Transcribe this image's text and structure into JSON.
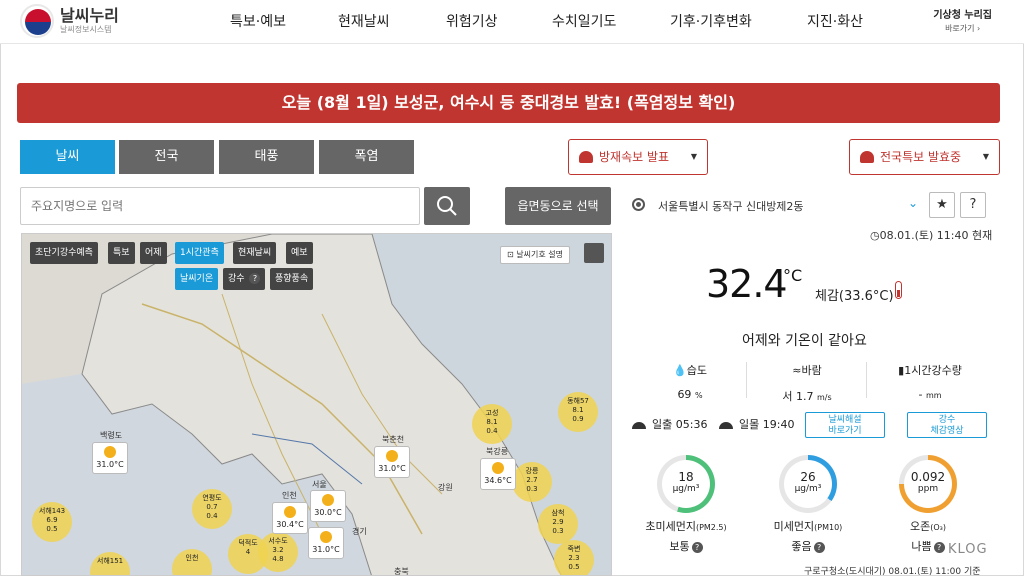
{
  "header": {
    "logo_title": "날씨누리",
    "logo_sub": "날씨정보시스템",
    "nav": [
      "특보·예보",
      "현재날씨",
      "위험기상",
      "수치일기도",
      "기후·기후변화",
      "지진·화산"
    ],
    "portal_title": "기상청 누리집",
    "portal_sub": "바로가기 ›"
  },
  "alert": "오늘 (8월 1일) 보성군, 여수시 등 중대경보 발효! (폭염정보 확인)",
  "tabs": [
    "날씨",
    "전국",
    "태풍",
    "폭염"
  ],
  "dropdowns": {
    "disaster": "방재속보 발표",
    "warning": "전국특보 발효중"
  },
  "search": {
    "placeholder": "주요지명으로 입력",
    "region_button": "읍면동으로 선택"
  },
  "location": {
    "name": "서울특별시 동작구 신대방제2동",
    "obs_time": "08.01.(토) 11:40 현재"
  },
  "weather": {
    "temp": "32.4",
    "unit": "°C",
    "feel": "체감(33.6°C)",
    "compare": "어제와 기온이 같아요",
    "humidity_label": "습도",
    "humidity_value": "69",
    "humidity_unit": "%",
    "wind_label": "바람",
    "wind_value": "서 1.7",
    "wind_unit": "m/s",
    "rain_label": "1시간강수량",
    "rain_value": "-",
    "rain_unit": "mm",
    "sunrise_label": "일출",
    "sunrise": "05:36",
    "sunset_label": "일몰",
    "sunset": "19:40",
    "link1": "날씨해설\n바로가기",
    "link2": "강수\n체감영상"
  },
  "air": [
    {
      "value": "18",
      "unit": "μg/m³",
      "label": "초미세먼지",
      "sub": "(PM2.5)",
      "grade": "보통",
      "color": "#4ec07a",
      "fill": 0.55
    },
    {
      "value": "26",
      "unit": "μg/m³",
      "label": "미세먼지",
      "sub": "(PM10)",
      "grade": "좋음",
      "color": "#2f9ee0",
      "fill": 0.35
    },
    {
      "value": "0.092",
      "unit": "ppm",
      "label": "오존",
      "sub": "(O₃)",
      "grade": "나쁨",
      "color": "#f0a030",
      "fill": 0.75
    }
  ],
  "source": "구로구청소(도시대기) 08.01.(토) 11:00 기준",
  "watermark": "KLOG",
  "map": {
    "buttons_row1": [
      "초단기강수예측",
      "특보",
      "어제",
      "1시간관측",
      "현재날씨",
      "예보"
    ],
    "buttons_row2": [
      "날씨기온",
      "강수",
      "풍향풍속"
    ],
    "info": "날씨기호 설명",
    "bubbles": [
      {
        "name": "백령도",
        "v1": "",
        "v2": ""
      },
      {
        "name": "서해143",
        "v1": "6.9",
        "v2": "0.5"
      },
      {
        "name": "연평도",
        "v1": "0.7",
        "v2": "0.4"
      },
      {
        "name": "덕적도",
        "v1": "4",
        "v2": ""
      },
      {
        "name": "서수도",
        "v1": "3.2",
        "v2": "4.8"
      },
      {
        "name": "서해151",
        "v1": "",
        "v2": ""
      },
      {
        "name": "인천",
        "v1": "",
        "v2": ""
      },
      {
        "name": "고성",
        "v1": "8.1",
        "v2": "0.4"
      },
      {
        "name": "동해57",
        "v1": "8.1",
        "v2": "0.9"
      },
      {
        "name": "강릉",
        "v1": "2.7",
        "v2": "0.3"
      },
      {
        "name": "삼척",
        "v1": "2.9",
        "v2": "0.3"
      },
      {
        "name": "죽변",
        "v1": "2.3",
        "v2": "0.5"
      }
    ],
    "cards": [
      {
        "temp": "31.0°C"
      },
      {
        "temp": "31.0°C"
      },
      {
        "temp": "34.6°C"
      },
      {
        "temp": "30.4°C"
      },
      {
        "temp": "30.0°C"
      },
      {
        "temp": "31.0°C"
      }
    ],
    "towns": [
      "북춘천",
      "북강릉",
      "강원",
      "서울",
      "인천",
      "경기",
      "충북"
    ]
  }
}
